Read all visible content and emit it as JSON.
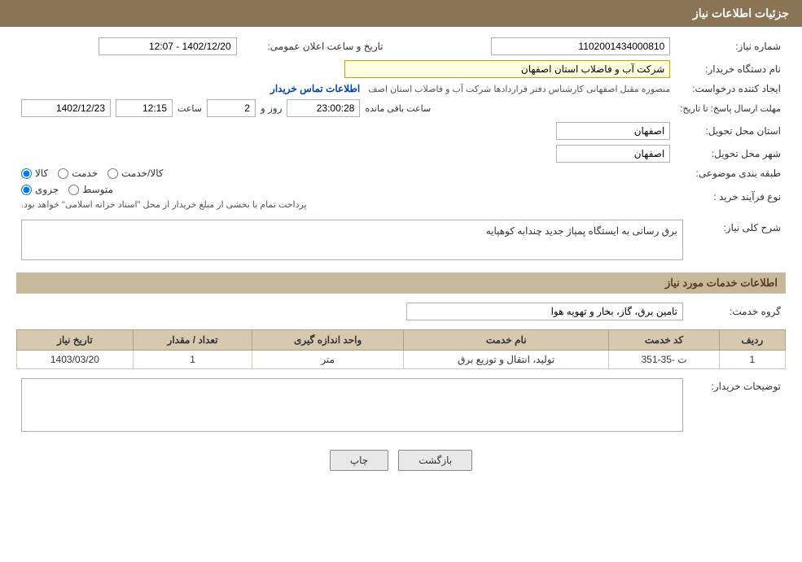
{
  "page": {
    "title": "جزئیات اطلاعات نیاز"
  },
  "header": {
    "label": "جزئیات اطلاعات نیاز"
  },
  "fields": {
    "need_number_label": "شماره نیاز:",
    "need_number_value": "1102001434000810",
    "buyer_org_label": "نام دستگاه خریدار:",
    "buyer_org_value": "شرکت آب و فاضلاب استان اصفهان",
    "creator_label": "ایجاد کننده درخواست:",
    "creator_value": "منصوره مقبل اصفهانی کارشناس دفتر قراردادها شرکت آب و فاضلاب استان اصف",
    "creator_link": "اطلاعات تماس خریدار",
    "deadline_label": "مهلت ارسال پاسخ: تا تاریخ:",
    "deadline_date": "1402/12/23",
    "deadline_time": "12:15",
    "deadline_days": "2",
    "deadline_countdown": "23:00:28",
    "deadline_remaining": "ساعت باقی مانده",
    "deadline_unit": "روز و",
    "announce_label": "تاریخ و ساعت اعلان عمومی:",
    "announce_value": "1402/12/20 - 12:07",
    "province_label": "استان محل تحویل:",
    "province_value": "اصفهان",
    "city_label": "شهر محل تحویل:",
    "city_value": "اصفهان",
    "category_label": "طبقه بندی موضوعی:",
    "category_kala": "کالا",
    "category_khedmat": "خدمت",
    "category_kala_khedmat": "کالا/خدمت",
    "process_label": "نوع فرآیند خرید :",
    "process_jozvi": "جزوی",
    "process_motovasset": "متوسط",
    "process_note": "پرداخت تمام یا بخشی از مبلغ خریدار از محل \"اسناد خزانه اسلامی\" خواهد بود.",
    "description_section": "شرح کلی نیاز:",
    "description_value": "برق رسانی به ایستگاه پمپاژ جدید چندابه کوهپایه",
    "services_section_title": "اطلاعات خدمات مورد نیاز",
    "service_group_label": "گروه خدمت:",
    "service_group_value": "تامین برق، گاز، بخار و تهویه هوا",
    "table": {
      "headers": [
        "ردیف",
        "کد خدمت",
        "نام خدمت",
        "واحد اندازه گیری",
        "تعداد / مقدار",
        "تاریخ نیاز"
      ],
      "rows": [
        {
          "row": "1",
          "code": "ت -35-351",
          "name": "تولید، انتقال و توزیع برق",
          "unit": "متر",
          "quantity": "1",
          "date": "1403/03/20"
        }
      ]
    },
    "buyer_desc_label": "توضیحات خریدار:",
    "buyer_desc_value": ""
  },
  "buttons": {
    "print": "چاپ",
    "back": "بازگشت"
  }
}
